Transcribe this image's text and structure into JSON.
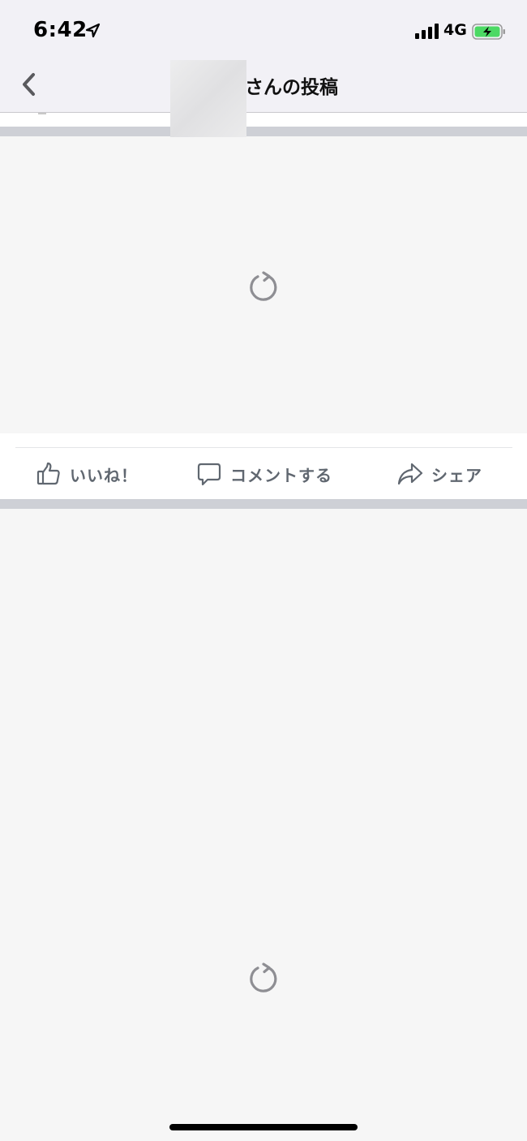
{
  "status_bar": {
    "time": "6:42",
    "network": "4G"
  },
  "nav": {
    "title": "さんの投稿",
    "back_icon": "chevron-left-icon"
  },
  "actions": {
    "like_label": "いいね！",
    "comment_label": "コメントする",
    "share_label": "シェア"
  },
  "icons": {
    "like": "thumbs-up-icon",
    "comment": "speech-bubble-icon",
    "share": "share-arrow-icon",
    "loading": "reload-spinner-icon"
  },
  "colors": {
    "nav_background": "#f2f1f6",
    "content_background": "#f6f6f6",
    "separator": "#ced0d6",
    "action_text": "#606770",
    "battery_fill": "#4cd964"
  }
}
